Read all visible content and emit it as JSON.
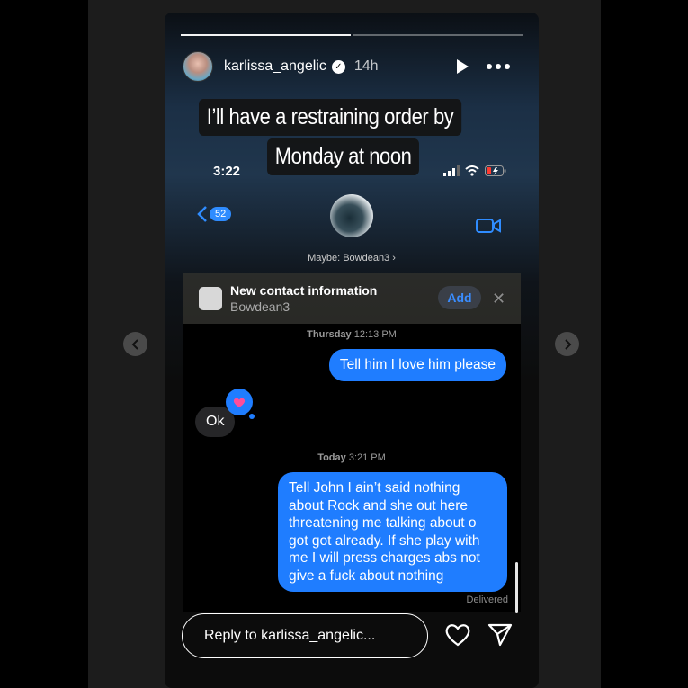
{
  "story": {
    "progress_segments": 2,
    "progress_done": 1,
    "username": "karlissa_angelic",
    "time_ago": "14h",
    "caption_line1": "I’ll have a restraining order by",
    "caption_line2": "Monday at noon"
  },
  "phone": {
    "clock": "3:22",
    "back_count": "52",
    "contact_hint": "Maybe: Bowdean3",
    "new_contact_title": "New contact information",
    "new_contact_name": "Bowdean3",
    "add_label": "Add"
  },
  "chat": {
    "ts1_day": "Thursday",
    "ts1_time": "12:13 PM",
    "msg1": "Tell him I love him please",
    "msg2": "Ok",
    "ts2_day": "Today",
    "ts2_time": "3:21 PM",
    "msg3_lines": [
      "Tell John I ain’t said nothing",
      "about Rock and she out here",
      "threatening me talking about o",
      "got got already. If she play with",
      "me I will press charges abs not",
      "give a fuck about nothing"
    ],
    "status": "Delivered"
  },
  "reply": {
    "placeholder": "Reply to karlissa_angelic..."
  },
  "colors": {
    "imessage_blue": "#1f7dff",
    "link_blue": "#2f8cff",
    "heart_pink": "#ff4d9a"
  }
}
